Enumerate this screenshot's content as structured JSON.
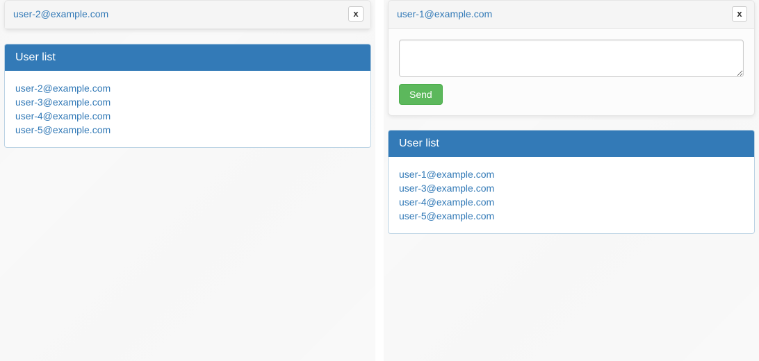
{
  "left": {
    "modal": {
      "title": "user-2@example.com",
      "close": "x"
    },
    "userlist": {
      "heading": "User list",
      "items": [
        "user-2@example.com",
        "user-3@example.com",
        "user-4@example.com",
        "user-5@example.com"
      ]
    }
  },
  "right": {
    "modal": {
      "title": "user-1@example.com",
      "close": "x",
      "message_value": "",
      "send_label": "Send"
    },
    "userlist": {
      "heading": "User list",
      "items": [
        "user-1@example.com",
        "user-3@example.com",
        "user-4@example.com",
        "user-5@example.com"
      ]
    }
  }
}
